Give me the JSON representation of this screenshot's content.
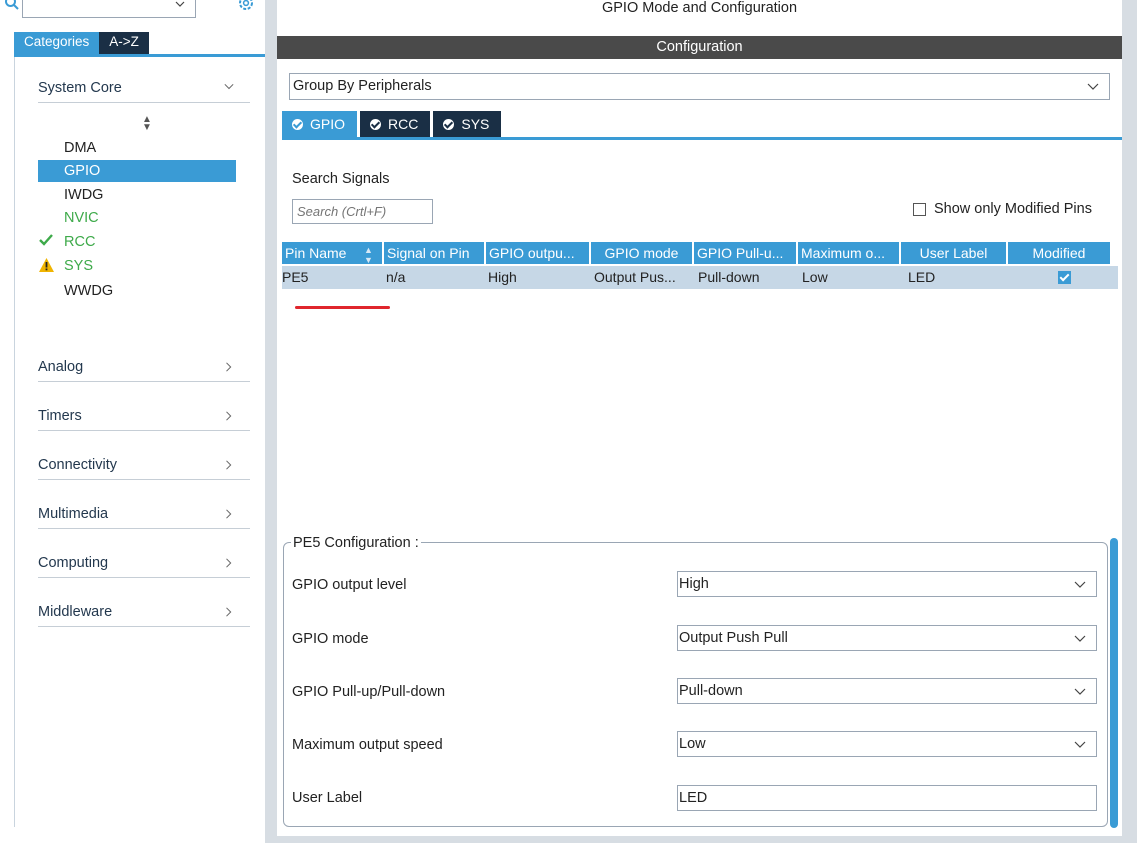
{
  "left": {
    "search_value": "",
    "tabs": {
      "categories": "Categories",
      "az": "A->Z"
    },
    "categories": {
      "system_core": "System Core",
      "analog": "Analog",
      "timers": "Timers",
      "connectivity": "Connectivity",
      "multimedia": "Multimedia",
      "computing": "Computing",
      "middleware": "Middleware"
    },
    "system_core_items": {
      "dma": "DMA",
      "gpio": "GPIO",
      "iwdg": "IWDG",
      "nvic": "NVIC",
      "rcc": "RCC",
      "sys": "SYS",
      "wwdg": "WWDG"
    }
  },
  "main": {
    "title": "GPIO Mode and Configuration",
    "config_bar": "Configuration",
    "group_by": "Group By Peripherals",
    "peripheral_tabs": {
      "gpio": "GPIO",
      "rcc": "RCC",
      "sys": "SYS"
    },
    "search_signals_label": "Search Signals",
    "search_placeholder": "Search (Crtl+F)",
    "show_only_modified": "Show only Modified Pins",
    "table": {
      "headers": {
        "pin_name": "Pin Name",
        "signal": "Signal on Pin",
        "gpio_output": "GPIO outpu...",
        "gpio_mode": "GPIO mode",
        "gpio_pull": "GPIO Pull-u...",
        "max_speed": "Maximum o...",
        "user_label": "User Label",
        "modified": "Modified"
      },
      "row": {
        "pin_name": "PE5",
        "signal": "n/a",
        "gpio_output": "High",
        "gpio_mode": "Output Pus...",
        "gpio_pull": "Pull-down",
        "max_speed": "Low",
        "user_label": "LED",
        "modified": true
      }
    },
    "pin_config": {
      "legend": "PE5 Configuration :",
      "output_level_label": "GPIO output level",
      "output_level_value": "High",
      "mode_label": "GPIO mode",
      "mode_value": "Output Push Pull",
      "pull_label": "GPIO Pull-up/Pull-down",
      "pull_value": "Pull-down",
      "speed_label": "Maximum output speed",
      "speed_value": "Low",
      "user_label_label": "User Label",
      "user_label_value": "LED"
    }
  },
  "colors": {
    "accent": "#3a9bd5",
    "dark_tab": "#1a2f45",
    "config_bar": "#4a4a4a",
    "status_green": "#3eaa4a",
    "warning": "#f0b400",
    "marker_red": "#e0262d",
    "row_bg": "#c6d7e6"
  },
  "icons": [
    "search-icon",
    "chevron-down-icon",
    "gear-icon",
    "sort-icon",
    "check-icon",
    "warning-icon",
    "chevron-right-icon",
    "check-circle-icon"
  ]
}
